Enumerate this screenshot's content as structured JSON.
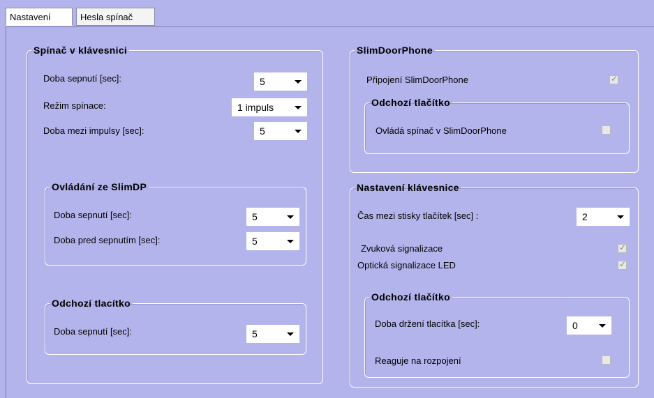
{
  "tabs": {
    "nastaveni": "Nastavení",
    "hesla": "Hesla spínač"
  },
  "left": {
    "group_spinac": {
      "title": "Spínač v klávesnici",
      "doba_sepnuti": {
        "label": "Doba sepnutí [sec]:",
        "value": "5"
      },
      "rezim": {
        "label": "Režim spínace:",
        "value": "1 impuls"
      },
      "doba_mezi": {
        "label": "Doba mezi impulsy [sec]:",
        "value": "5"
      }
    },
    "group_slimdp": {
      "title": "Ovládání ze SlimDP",
      "doba_sepnuti": {
        "label": "Doba sepnutí [sec]:",
        "value": "5"
      },
      "doba_pred": {
        "label": "Doba pred sepnutím [sec]:",
        "value": "5"
      }
    },
    "group_odchozi": {
      "title": "Odchozí tlacítko",
      "doba_sepnuti": {
        "label": "Doba sepnutí [sec]:",
        "value": "5"
      }
    }
  },
  "right": {
    "group_slimdoorphone": {
      "title": "SlimDoorPhone",
      "pripojeni": {
        "label": "Připojení SlimDoorPhone",
        "checked": true
      },
      "odchozi": {
        "title": "Odchozí tlačítko",
        "ovlada": {
          "label": "Ovládá spínač v SlimDoorPhone",
          "checked": false
        }
      }
    },
    "group_klavesnice": {
      "title": "Nastavení klávesnice",
      "cas_mezi": {
        "label": "Čas mezi stisky tlačítek [sec] :",
        "value": "2"
      },
      "zvukova": {
        "label": "Zvuková signalizace",
        "checked": true
      },
      "opticka": {
        "label": "Optická signalizace LED",
        "checked": true
      },
      "odchozi": {
        "title": "Odchozí tlačítko",
        "doba_drzeni": {
          "label": "Doba držení tlacítka [sec]:",
          "value": "0"
        },
        "reaguje": {
          "label": "Reaguje na rozpojení",
          "checked": false
        }
      }
    }
  },
  "icons": {
    "dropdown": "chevron-down-icon",
    "check": "checkmark-icon"
  }
}
